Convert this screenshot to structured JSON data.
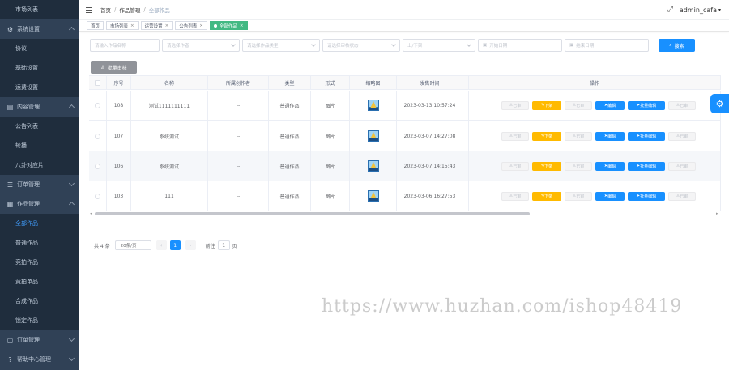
{
  "sidebar": {
    "items": [
      {
        "label": "市场列表",
        "type": "sub"
      },
      {
        "label": "系统设置",
        "type": "group",
        "icon": "gear-icon",
        "arrow": "up"
      },
      {
        "label": "协议",
        "type": "sub"
      },
      {
        "label": "基础设置",
        "type": "sub"
      },
      {
        "label": "运费设置",
        "type": "sub"
      },
      {
        "label": "内容管理",
        "type": "group",
        "icon": "document-icon",
        "arrow": "up"
      },
      {
        "label": "公告列表",
        "type": "sub"
      },
      {
        "label": "轮播",
        "type": "sub"
      },
      {
        "label": "八卦对应片",
        "type": "sub"
      },
      {
        "label": "订单管理",
        "type": "group",
        "icon": "list-icon",
        "arrow": "down"
      },
      {
        "label": "作品管理",
        "type": "group",
        "icon": "grid-icon",
        "arrow": "up"
      },
      {
        "label": "全部作品",
        "type": "sub",
        "active": true
      },
      {
        "label": "普通作品",
        "type": "sub"
      },
      {
        "label": "竞拍作品",
        "type": "sub"
      },
      {
        "label": "竞拍单品",
        "type": "sub"
      },
      {
        "label": "合成作品",
        "type": "sub"
      },
      {
        "label": "锁定作品",
        "type": "sub"
      },
      {
        "label": "订单管理",
        "type": "group",
        "icon": "order-icon",
        "arrow": "down"
      },
      {
        "label": "帮助中心管理",
        "type": "group",
        "icon": "help-icon",
        "arrow": "down"
      }
    ]
  },
  "navbar": {
    "breadcrumb": [
      "首页",
      "作品管理",
      "全部作品"
    ],
    "user": "admin_cafa"
  },
  "tags": [
    {
      "label": "首页",
      "closable": false
    },
    {
      "label": "市场列表",
      "closable": true
    },
    {
      "label": "运营设置",
      "closable": true
    },
    {
      "label": "公告列表",
      "closable": true
    },
    {
      "label": "全部作品",
      "closable": true,
      "active": true
    }
  ],
  "search": {
    "fields": [
      {
        "placeholder": "请输入作品名称",
        "width": 86,
        "dropdown": false
      },
      {
        "placeholder": "请选择作者",
        "width": 96,
        "dropdown": true
      },
      {
        "placeholder": "请选择作品类型",
        "width": 96,
        "dropdown": true
      },
      {
        "placeholder": "请选择审核状态",
        "width": 96,
        "dropdown": true
      },
      {
        "placeholder": "上/下架",
        "width": 90,
        "dropdown": true
      },
      {
        "placeholder": "开始日期",
        "width": 104,
        "dropdown": false,
        "calendar": true
      },
      {
        "placeholder": "结束日期",
        "width": 104,
        "dropdown": false,
        "calendar": true
      }
    ],
    "button": "搜索"
  },
  "batch_button": "批量审核",
  "table": {
    "columns": [
      "",
      "序号",
      "名称",
      "所属创作者",
      "类型",
      "形式",
      "缩略图",
      "发售时间",
      "",
      "操作"
    ],
    "action_labels": [
      "已审",
      "下架",
      "已审",
      "编辑",
      "批量编辑",
      "已审"
    ],
    "rows": [
      {
        "id": "108",
        "name": "测试1111111111",
        "creator": "--",
        "type": "普通作品",
        "form": "图片",
        "time": "2023-03-13 10:57:24"
      },
      {
        "id": "107",
        "name": "系统测试",
        "creator": "--",
        "type": "普通作品",
        "form": "图片",
        "time": "2023-03-07 14:27:08"
      },
      {
        "id": "106",
        "name": "系统测试",
        "creator": "--",
        "type": "普通作品",
        "form": "图片",
        "time": "2023-03-07 14:15:43"
      },
      {
        "id": "103",
        "name": "111",
        "creator": "--",
        "type": "普通作品",
        "form": "图片",
        "time": "2023-03-06 16:27:53"
      }
    ]
  },
  "pagination": {
    "total": "共 4 条",
    "page_size": "20条/页",
    "current": "1",
    "goto_label": "前往",
    "goto_value": "1",
    "page_unit": "页"
  },
  "watermark": "https://www.huzhan.com/ishop48419",
  "colors": {
    "sidebar": "#304156",
    "primary": "#1890ff",
    "warning": "#ffba00",
    "tag_active": "#42b983"
  }
}
